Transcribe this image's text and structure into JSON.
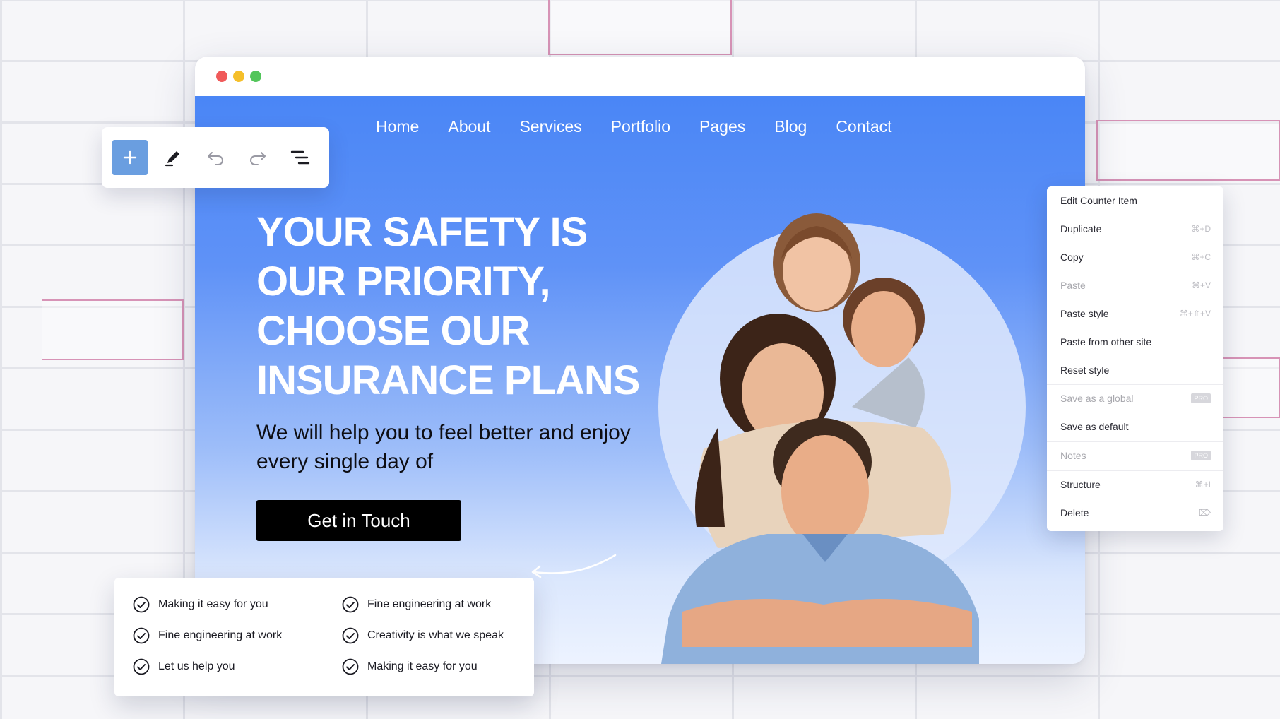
{
  "nav": {
    "items": [
      "Home",
      "About",
      "Services",
      "Portfolio",
      "Pages",
      "Blog",
      "Contact"
    ]
  },
  "hero": {
    "title_lines": [
      "YOUR SAFETY IS",
      "OUR PRIORITY,",
      "CHOOSE OUR",
      "INSURANCE PLANS"
    ],
    "subtitle_lines": [
      "We will help you to feel better and enjoy",
      "every single day of"
    ],
    "cta_label": "Get in Touch"
  },
  "toolbar": {
    "icons": [
      "plus-icon",
      "pencil-icon",
      "undo-icon",
      "redo-icon",
      "structure-icon"
    ]
  },
  "context_menu": {
    "items": [
      {
        "label": "Edit Counter Item",
        "shortcut": "",
        "disabled": false
      },
      {
        "label": "Duplicate",
        "shortcut": "⌘+D",
        "disabled": false
      },
      {
        "label": "Copy",
        "shortcut": "⌘+C",
        "disabled": false
      },
      {
        "label": "Paste",
        "shortcut": "⌘+V",
        "disabled": true
      },
      {
        "label": "Paste style",
        "shortcut": "⌘+⇧+V",
        "disabled": false
      },
      {
        "label": "Paste from other site",
        "shortcut": "",
        "disabled": false
      },
      {
        "label": "Reset style",
        "shortcut": "",
        "disabled": false
      },
      {
        "label": "Save as a global",
        "shortcut": "PRO",
        "disabled": true
      },
      {
        "label": "Save as default",
        "shortcut": "",
        "disabled": false
      },
      {
        "label": "Notes",
        "shortcut": "PRO",
        "disabled": true
      },
      {
        "label": "Structure",
        "shortcut": "⌘+I",
        "disabled": false
      },
      {
        "label": "Delete",
        "shortcut": "⌦",
        "disabled": false
      }
    ]
  },
  "features": {
    "left": [
      "Making it easy for you",
      "Fine engineering at work",
      "Let us help you"
    ],
    "right": [
      "Fine engineering at work",
      "Creativity is what we speak",
      "Making it easy for you"
    ]
  },
  "colors": {
    "hero_blue": "#4a86f6",
    "cta_bg": "#000000",
    "accent_pink": "#d793b6"
  }
}
